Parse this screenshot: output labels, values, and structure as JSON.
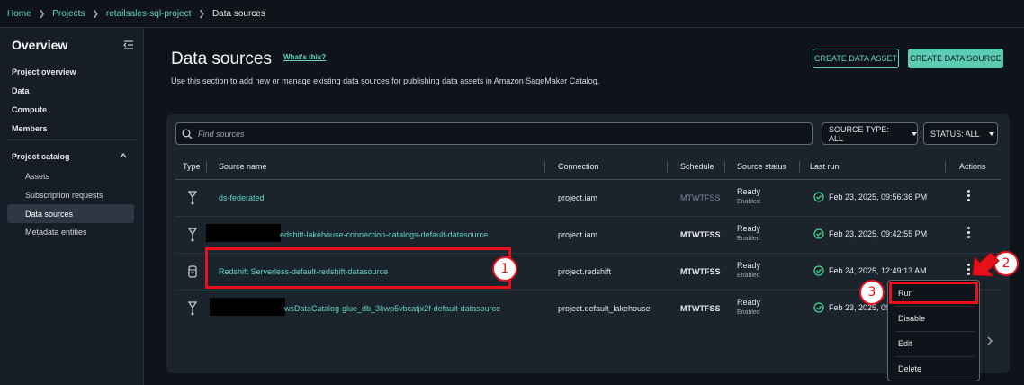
{
  "breadcrumb": {
    "home": "Home",
    "projects": "Projects",
    "project": "retailsales-sql-project",
    "current": "Data sources"
  },
  "sidebar": {
    "title": "Overview",
    "items": [
      "Project overview",
      "Data",
      "Compute",
      "Members"
    ],
    "catalog_label": "Project catalog",
    "catalog_items": [
      "Assets",
      "Subscription requests",
      "Data sources",
      "Metadata entities"
    ],
    "active": "Data sources"
  },
  "page": {
    "title": "Data sources",
    "whats_this": "What's this?",
    "description": "Use this section to add new or manage existing data sources for publishing data assets in Amazon SageMaker Catalog.",
    "create_asset": "CREATE DATA ASSET",
    "create_source": "CREATE DATA SOURCE"
  },
  "filters": {
    "search_placeholder": "Find sources",
    "source_type": "SOURCE TYPE: ALL",
    "status": "STATUS: ALL"
  },
  "table": {
    "headers": {
      "type": "Type",
      "name": "Source name",
      "connection": "Connection",
      "schedule": "Schedule",
      "status": "Source status",
      "last_run": "Last run",
      "actions": "Actions"
    },
    "rows": [
      {
        "icon": "glue-crawler-icon",
        "name": "ds-federated",
        "connection": "project.iam",
        "schedule": "MTWTFSS",
        "schedule_enabled": false,
        "status": "Ready",
        "status_sub": "Enabled",
        "last_run": "Feb 23, 2025, 09:56:36 PM"
      },
      {
        "icon": "glue-crawler-icon",
        "name": "edshift-lakehouse-connection-catalogs-default-datasource",
        "connection": "project.iam",
        "schedule": "MTWTFSS",
        "schedule_enabled": true,
        "status": "Ready",
        "status_sub": "Enabled",
        "last_run": "Feb 23, 2025, 09:42:55 PM"
      },
      {
        "icon": "redshift-database-icon",
        "name": "Redshift Serverless-default-redshift-datasource",
        "connection": "project.redshift",
        "schedule": "MTWTFSS",
        "schedule_enabled": true,
        "status": "Ready",
        "status_sub": "Enabled",
        "last_run": "Feb 24, 2025, 12:49:13 AM"
      },
      {
        "icon": "glue-crawler-icon",
        "name": "wsDataCatalog-glue_db_3kwp5vbcatjx2f-default-datasource",
        "connection": "project.default_lakehouse",
        "schedule": "MTWTFSS",
        "schedule_enabled": true,
        "status": "Ready",
        "status_sub": "Enabled",
        "last_run": "Feb 23, 2025, 09"
      }
    ]
  },
  "actions_menu": {
    "items": [
      "Run",
      "Disable",
      "Edit",
      "Delete"
    ]
  },
  "annotations": {
    "callout_1": "1",
    "callout_2": "2",
    "callout_3": "3",
    "highlight_color": "#e8101a"
  },
  "colors": {
    "accent": "#63d4c1",
    "button_solid": "#5ccdb4",
    "success": "#3ed38a",
    "background": "#0f141a"
  }
}
